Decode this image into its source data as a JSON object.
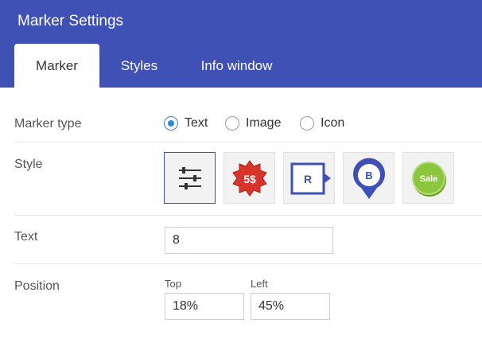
{
  "header": {
    "title": "Marker Settings",
    "bg_color": "#3f51b5"
  },
  "tabs": [
    {
      "label": "Marker",
      "active": true
    },
    {
      "label": "Styles",
      "active": false
    },
    {
      "label": "Info window",
      "active": false
    }
  ],
  "marker_type": {
    "label": "Marker type",
    "options": [
      {
        "label": "Text",
        "checked": true
      },
      {
        "label": "Image",
        "checked": false
      },
      {
        "label": "Icon",
        "checked": false
      }
    ]
  },
  "style": {
    "label": "Style",
    "options": [
      {
        "name": "sliders-icon",
        "selected": true
      },
      {
        "name": "price-burst-icon",
        "text": "5$",
        "selected": false
      },
      {
        "name": "square-arrow-marker-icon",
        "text": "R",
        "selected": false
      },
      {
        "name": "pin-marker-icon",
        "text": "B",
        "selected": false
      },
      {
        "name": "sale-badge-icon",
        "text": "Sale",
        "selected": false
      }
    ]
  },
  "text_field": {
    "label": "Text",
    "value": "8"
  },
  "position": {
    "label": "Position",
    "top": {
      "label": "Top",
      "value": "18%"
    },
    "left": {
      "label": "Left",
      "value": "45%"
    }
  }
}
